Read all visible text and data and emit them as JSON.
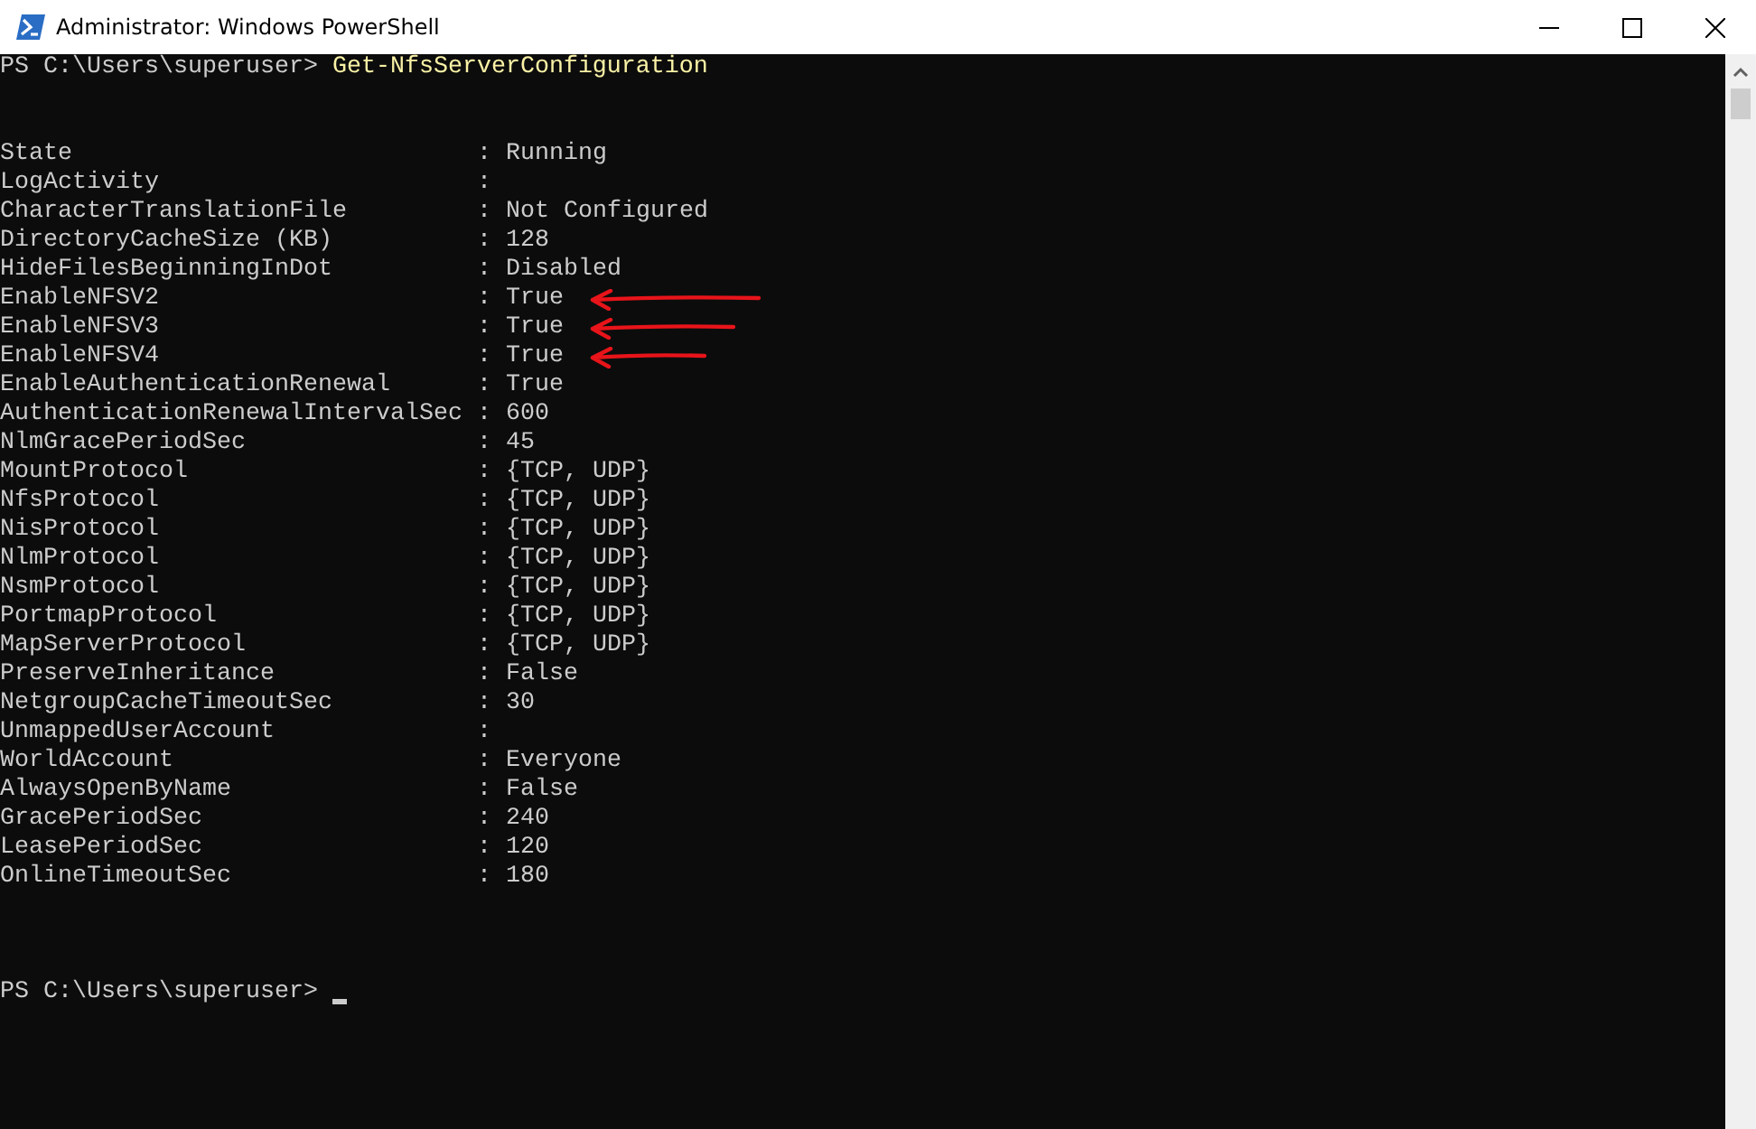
{
  "window": {
    "title": "Administrator: Windows PowerShell"
  },
  "command_line": {
    "prompt": "PS C:\\Users\\superuser>",
    "command": "Get-NfsServerConfiguration"
  },
  "output": [
    {
      "name": "State",
      "separator": ":",
      "value": "Running",
      "annotated": false
    },
    {
      "name": "LogActivity",
      "separator": ":",
      "annotated": false
    },
    {
      "name": "CharacterTranslationFile",
      "separator": ":",
      "value": "Not Configured",
      "annotated": false
    },
    {
      "name": "DirectoryCacheSize (KB)",
      "separator": ":",
      "value": "128",
      "annotated": false
    },
    {
      "name": "HideFilesBeginningInDot",
      "separator": ":",
      "value": "Disabled",
      "annotated": false
    },
    {
      "name": "EnableNFSV2",
      "separator": ":",
      "value": "True",
      "annotated": true
    },
    {
      "name": "EnableNFSV3",
      "separator": ":",
      "value": "True",
      "annotated": true
    },
    {
      "name": "EnableNFSV4",
      "separator": ":",
      "value": "True",
      "annotated": true
    },
    {
      "name": "EnableAuthenticationRenewal",
      "separator": ":",
      "value": "True",
      "annotated": false
    },
    {
      "name": "AuthenticationRenewalIntervalSec",
      "separator": ":",
      "value": "600",
      "annotated": false
    },
    {
      "name": "NlmGracePeriodSec",
      "separator": ":",
      "value": "45",
      "annotated": false
    },
    {
      "name": "MountProtocol",
      "separator": ":",
      "value": "{TCP, UDP}",
      "annotated": false
    },
    {
      "name": "NfsProtocol",
      "separator": ":",
      "value": "{TCP, UDP}",
      "annotated": false
    },
    {
      "name": "NisProtocol",
      "separator": ":",
      "value": "{TCP, UDP}",
      "annotated": false
    },
    {
      "name": "NlmProtocol",
      "separator": ":",
      "value": "{TCP, UDP}",
      "annotated": false
    },
    {
      "name": "NsmProtocol",
      "separator": ":",
      "value": "{TCP, UDP}",
      "annotated": false
    },
    {
      "name": "PortmapProtocol",
      "separator": ":",
      "value": "{TCP, UDP}",
      "annotated": false
    },
    {
      "name": "MapServerProtocol",
      "separator": ":",
      "value": "{TCP, UDP}",
      "annotated": false
    },
    {
      "name": "PreserveInheritance",
      "separator": ":",
      "value": "False",
      "annotated": false
    },
    {
      "name": "NetgroupCacheTimeoutSec",
      "separator": ":",
      "value": "30",
      "annotated": false
    },
    {
      "name": "UnmappedUserAccount",
      "separator": ":",
      "annotated": false
    },
    {
      "name": "WorldAccount",
      "separator": ":",
      "value": "Everyone",
      "annotated": false
    },
    {
      "name": "AlwaysOpenByName",
      "separator": ":",
      "value": "False",
      "annotated": false
    },
    {
      "name": "GracePeriodSec",
      "separator": ":",
      "value": "240",
      "annotated": false
    },
    {
      "name": "LeasePeriodSec",
      "separator": ":",
      "value": "120",
      "annotated": false
    },
    {
      "name": "OnlineTimeoutSec",
      "separator": ":",
      "value": "180",
      "annotated": false
    }
  ],
  "prompt_line": {
    "prompt": "PS C:\\Users\\superuser>"
  }
}
